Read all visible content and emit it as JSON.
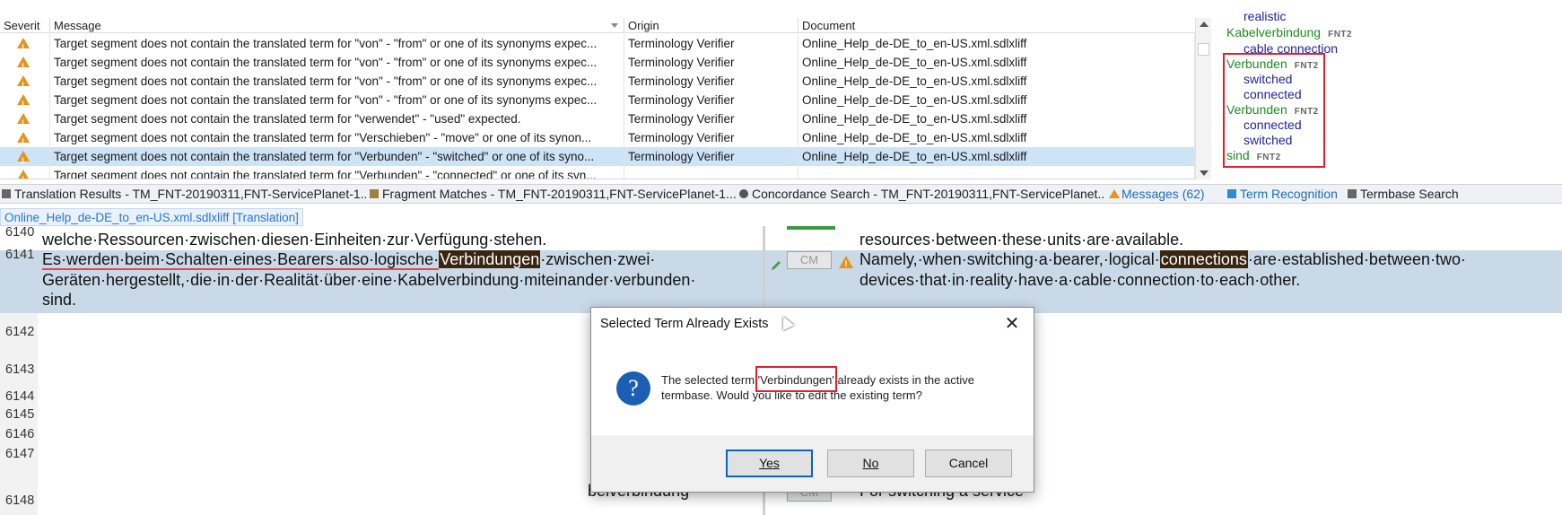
{
  "messages": {
    "columns": {
      "severity": "Severit",
      "message": "Message",
      "origin": "Origin",
      "document": "Document"
    },
    "rows": [
      {
        "message": "Target segment does not contain the translated term for \"von\" - \"from\" or one of its synonyms expec...",
        "origin": "Terminology Verifier",
        "document": "Online_Help_de-DE_to_en-US.xml.sdlxliff"
      },
      {
        "message": "Target segment does not contain the translated term for \"von\" - \"from\" or one of its synonyms expec...",
        "origin": "Terminology Verifier",
        "document": "Online_Help_de-DE_to_en-US.xml.sdlxliff"
      },
      {
        "message": "Target segment does not contain the translated term for \"von\" - \"from\" or one of its synonyms expec...",
        "origin": "Terminology Verifier",
        "document": "Online_Help_de-DE_to_en-US.xml.sdlxliff"
      },
      {
        "message": "Target segment does not contain the translated term for \"von\" - \"from\" or one of its synonyms expec...",
        "origin": "Terminology Verifier",
        "document": "Online_Help_de-DE_to_en-US.xml.sdlxliff"
      },
      {
        "message": "Target segment does not contain the translated term for \"verwendet\" - \"used\" expected.",
        "origin": "Terminology Verifier",
        "document": "Online_Help_de-DE_to_en-US.xml.sdlxliff"
      },
      {
        "message": "Target segment does not contain the translated term for \"Verschieben\" - \"move\" or one of its synon...",
        "origin": "Terminology Verifier",
        "document": "Online_Help_de-DE_to_en-US.xml.sdlxliff"
      },
      {
        "message": "Target segment does not contain the translated term for \"Verbunden\" - \"switched\" or one of its syno...",
        "origin": "Terminology Verifier",
        "document": "Online_Help_de-DE_to_en-US.xml.sdlxliff"
      },
      {
        "message": "Target segment does not contain the translated term for \"Verbunden\" - \"connected\" or one of its syn...",
        "origin": "",
        "document": ""
      }
    ]
  },
  "terms": {
    "partial_top": "realistic",
    "kabel": "Kabelverbindung",
    "kabel_tag": "FNT2",
    "kabel_en": "cable connection",
    "v1": "Verbunden",
    "v1_tag": "FNT2",
    "v1_en1": "switched",
    "v1_en2": "connected",
    "v2": "Verbunden",
    "v2_tag": "FNT2",
    "v2_en1": "connected",
    "v2_en2": "switched",
    "sind": "sind",
    "sind_tag": "FNT2"
  },
  "tabs": {
    "t1": "Translation Results - TM_FNT-20190311,FNT-ServicePlanet-1...",
    "t2": "Fragment Matches - TM_FNT-20190311,FNT-ServicePlanet-1...",
    "t3": "Concordance Search - TM_FNT-20190311,FNT-ServicePlanet...",
    "t4": "Messages (62)",
    "t5": "Term Recognition",
    "t6": "Termbase Search"
  },
  "doc_tab": "Online_Help_de-DE_to_en-US.xml.sdlxliff [Translation]",
  "editor": {
    "r6140": "6140",
    "src6140": "welche·Ressourcen·zwischen·diesen·Einheiten·zur·Verfügung·stehen.",
    "tgt6140": "resources·between·these·units·are·available.",
    "r6141": "6141",
    "src6141_a": "Es·werden·beim·Schalten·eines·Bearers·also·logische·",
    "src6141_hl": "Verbindungen",
    "src6141_b": "·zwischen·zwei·",
    "src6141_l2": "Geräten·hergestellt,·die·in·der·Realität·über·eine·Kabelverbindung·miteinander·verbunden·",
    "src6141_l3": "sind.",
    "status": "CM",
    "tgt6141_a": "Namely,·when·switching·a·bearer,·logical·",
    "tgt6141_hl": "connections",
    "tgt6141_b": "·are·established·between·two·",
    "tgt6141_l2": "devices·that·in·reality·have·a·cable·connection·to·each·other.",
    "r6142": "6142",
    "r6143": "6143",
    "r6144": "6144",
    "r6145": "6145",
    "r6146": "6146",
    "r6147": "6147",
    "r6148": "6148",
    "src6148": "belverbindung",
    "tgt6148": "For switching a service"
  },
  "dialog": {
    "title": "Selected Term Already Exists",
    "close": "✕",
    "msg_a": "The selected term ",
    "msg_term": "'Verbindungen'",
    "msg_b": " already exists in the active termbase. Would you like to edit the existing term?",
    "yes": "Yes",
    "no": "No",
    "cancel": "Cancel"
  }
}
